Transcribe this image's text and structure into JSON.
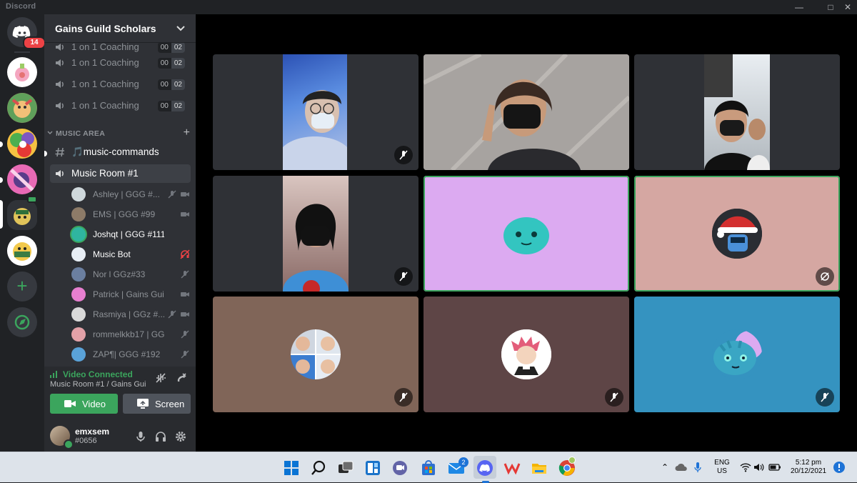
{
  "app": {
    "title": "Discord",
    "window_controls": [
      "minimize",
      "maximize",
      "close"
    ]
  },
  "rail": {
    "home_badge": "14",
    "servers": [
      "Potion server",
      "Axie server",
      "Colorful server",
      "Pink server",
      "Gains Guild server",
      "Gains Guild Scholars"
    ],
    "add_label": "+",
    "explore_label": "Explore"
  },
  "guild": {
    "name": "Gains Guild Scholars"
  },
  "channels": {
    "coaching": [
      {
        "label": "1 on 1 Coaching",
        "lim_a": "00",
        "lim_b": "02"
      },
      {
        "label": "1 on 1 Coaching",
        "lim_a": "00",
        "lim_b": "02"
      },
      {
        "label": "1 on 1 Coaching",
        "lim_a": "00",
        "lim_b": "02"
      },
      {
        "label": "1 on 1 Coaching",
        "lim_a": "00",
        "lim_b": "02"
      }
    ],
    "category": "MUSIC AREA",
    "music_commands": "🎵music-commands",
    "music_room": "Music Room #1"
  },
  "members": [
    {
      "name": "Ashley | GGG #...",
      "bright": false,
      "avatar_color": "#cfd8dc"
    },
    {
      "name": "EMS | GGG #99",
      "bright": false,
      "avatar_color": "#8d7b68"
    },
    {
      "name": "Joshqt | GGG #111",
      "bright": true,
      "avatar_color": "#2fb5a0"
    },
    {
      "name": "Music Bot",
      "bright": true,
      "avatar_color": "#e8eef5"
    },
    {
      "name": "Nor l GGz#33",
      "bright": false,
      "avatar_color": "#6b7fa0"
    },
    {
      "name": "Patrick | Gains Guild",
      "bright": false,
      "avatar_color": "#e77fd0"
    },
    {
      "name": "Rasmiya | GGz #...",
      "bright": false,
      "avatar_color": "#d9d9d9"
    },
    {
      "name": "rommelkkb17 | GG...",
      "bright": false,
      "avatar_color": "#e3a1a8"
    },
    {
      "name": "ZAP¶| GGG #192",
      "bright": false,
      "avatar_color": "#5aa2d8"
    }
  ],
  "voice": {
    "status": "Video Connected",
    "location": "Music Room #1 / Gains Gui...",
    "video_button": "Video",
    "screen_button": "Screen"
  },
  "user": {
    "name": "emxsem",
    "tag": "#0656"
  },
  "colors": {
    "accent_green": "#3ba55d",
    "blurple": "#5865f2",
    "danger": "#ed4245",
    "tile_pink": "#dcaaf1",
    "tile_rose": "#d5a7a2",
    "tile_brown": "#806558",
    "tile_maroon": "#5e4546",
    "tile_blue": "#3593c0"
  },
  "taskbar": {
    "apps": [
      "start",
      "search",
      "task-view",
      "widgets",
      "teams-chat",
      "store",
      "mail",
      "discord",
      "wps",
      "file-explorer",
      "chrome"
    ],
    "mail_badge": "2",
    "language_top": "ENG",
    "language_bottom": "US",
    "time": "5:12 pm",
    "date": "20/12/2021"
  }
}
